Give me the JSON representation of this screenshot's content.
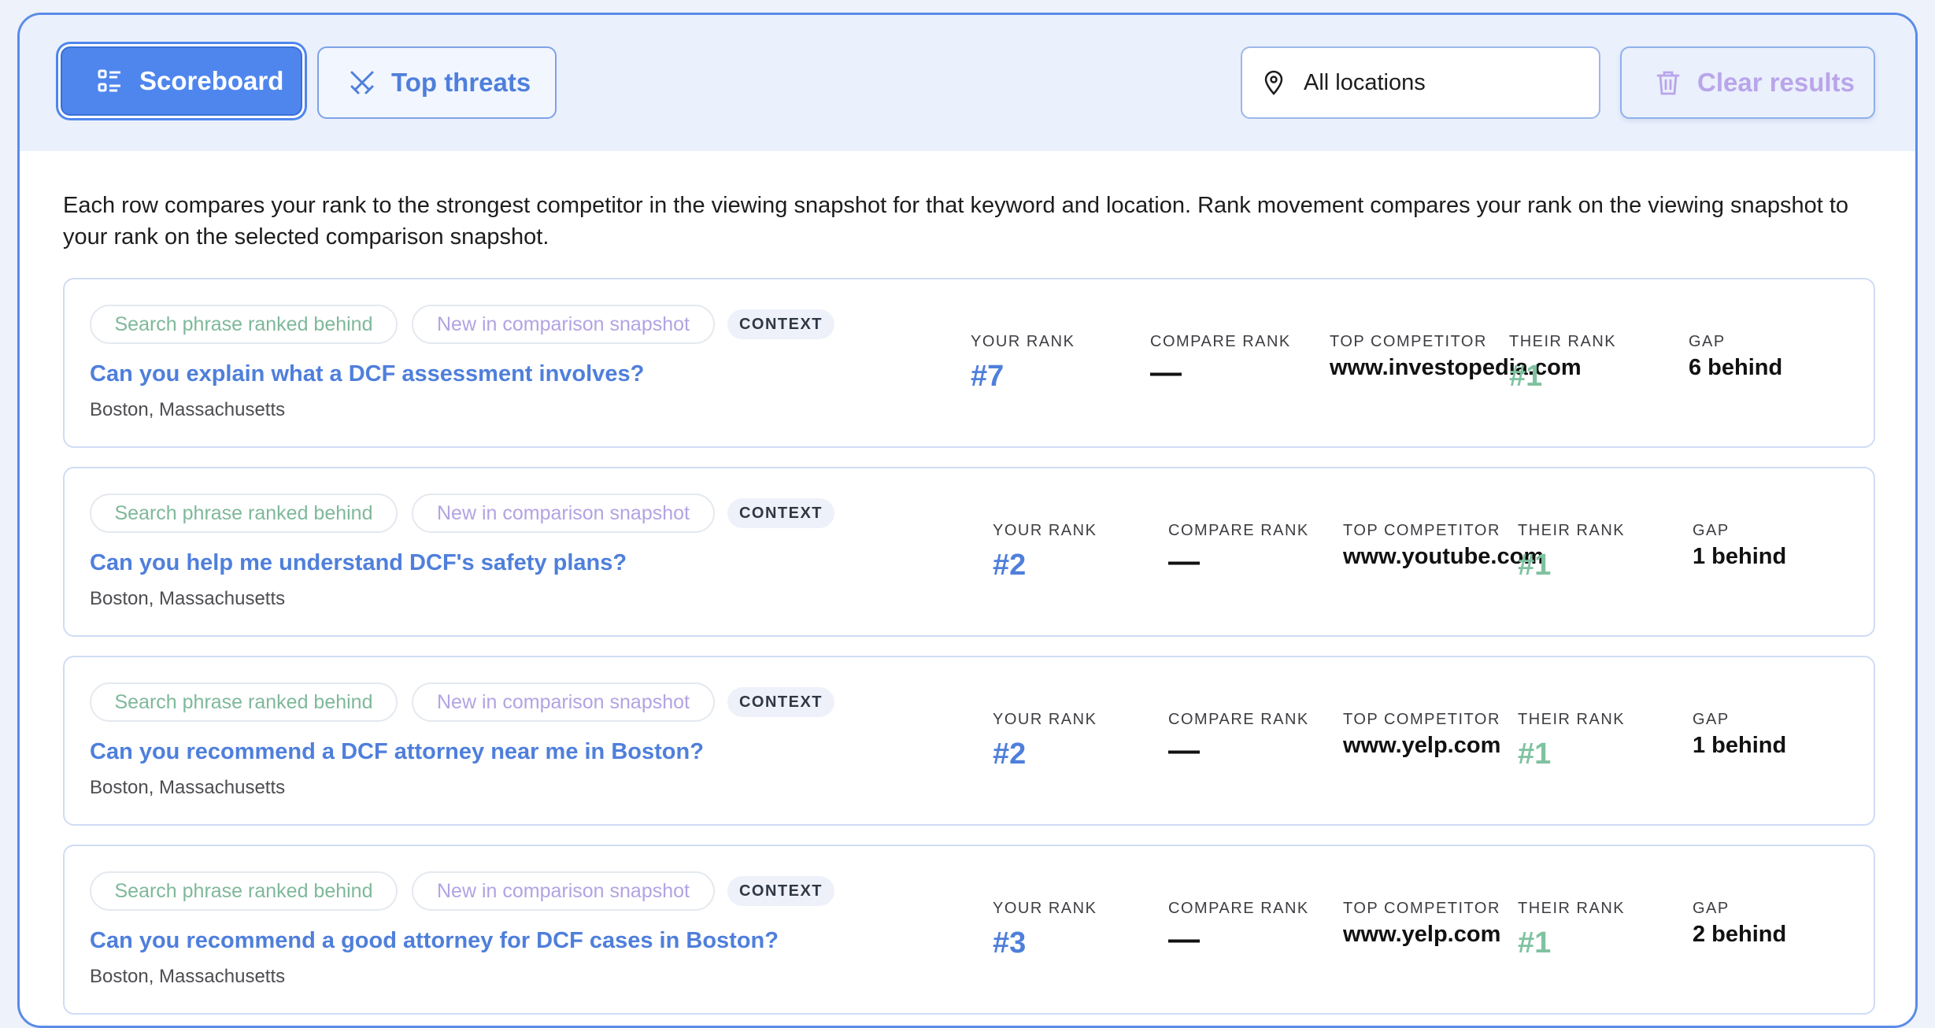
{
  "toolbar": {
    "scoreboard_label": "Scoreboard",
    "top_threats_label": "Top threats",
    "location_value": "All locations",
    "clear_label": "Clear results",
    "icons": {
      "scoreboard": "list-icon",
      "top_threats": "crossed-swords-icon",
      "location": "map-pin-icon",
      "clear": "trash-icon"
    }
  },
  "description": "Each row compares your rank to the strongest competitor in the viewing snapshot for that keyword and location. Rank movement compares your rank on the viewing snapshot to your rank on the selected comparison snapshot.",
  "column_labels": {
    "your_rank": "YOUR RANK",
    "compare_rank": "COMPARE RANK",
    "top_competitor": "TOP COMPETITOR",
    "their_rank": "THEIR RANK",
    "gap": "GAP"
  },
  "rows": [
    {
      "chip_behind": "Search phrase ranked behind",
      "chip_new": "New in comparison snapshot",
      "chip_context": "CONTEXT",
      "question": "Can you explain what a DCF assessment involves?",
      "location": "Boston, Massachusetts",
      "your_rank": "#7",
      "compare_rank": "—",
      "top_competitor": "www.investopedia.com",
      "their_rank": "#1",
      "gap": "6 behind"
    },
    {
      "chip_behind": "Search phrase ranked behind",
      "chip_new": "New in comparison snapshot",
      "chip_context": "CONTEXT",
      "question": "Can you help me understand DCF's safety plans?",
      "location": "Boston, Massachusetts",
      "your_rank": "#2",
      "compare_rank": "—",
      "top_competitor": "www.youtube.com",
      "their_rank": "#1",
      "gap": "1 behind"
    },
    {
      "chip_behind": "Search phrase ranked behind",
      "chip_new": "New in comparison snapshot",
      "chip_context": "CONTEXT",
      "question": "Can you recommend a DCF attorney near me in Boston?",
      "location": "Boston, Massachusetts",
      "your_rank": "#2",
      "compare_rank": "—",
      "top_competitor": "www.yelp.com",
      "their_rank": "#1",
      "gap": "1 behind"
    },
    {
      "chip_behind": "Search phrase ranked behind",
      "chip_new": "New in comparison snapshot",
      "chip_context": "CONTEXT",
      "question": "Can you recommend a good attorney for DCF cases in Boston?",
      "location": "Boston, Massachusetts",
      "your_rank": "#3",
      "compare_rank": "—",
      "top_competitor": "www.yelp.com",
      "their_rank": "#1",
      "gap": "2 behind"
    }
  ]
}
